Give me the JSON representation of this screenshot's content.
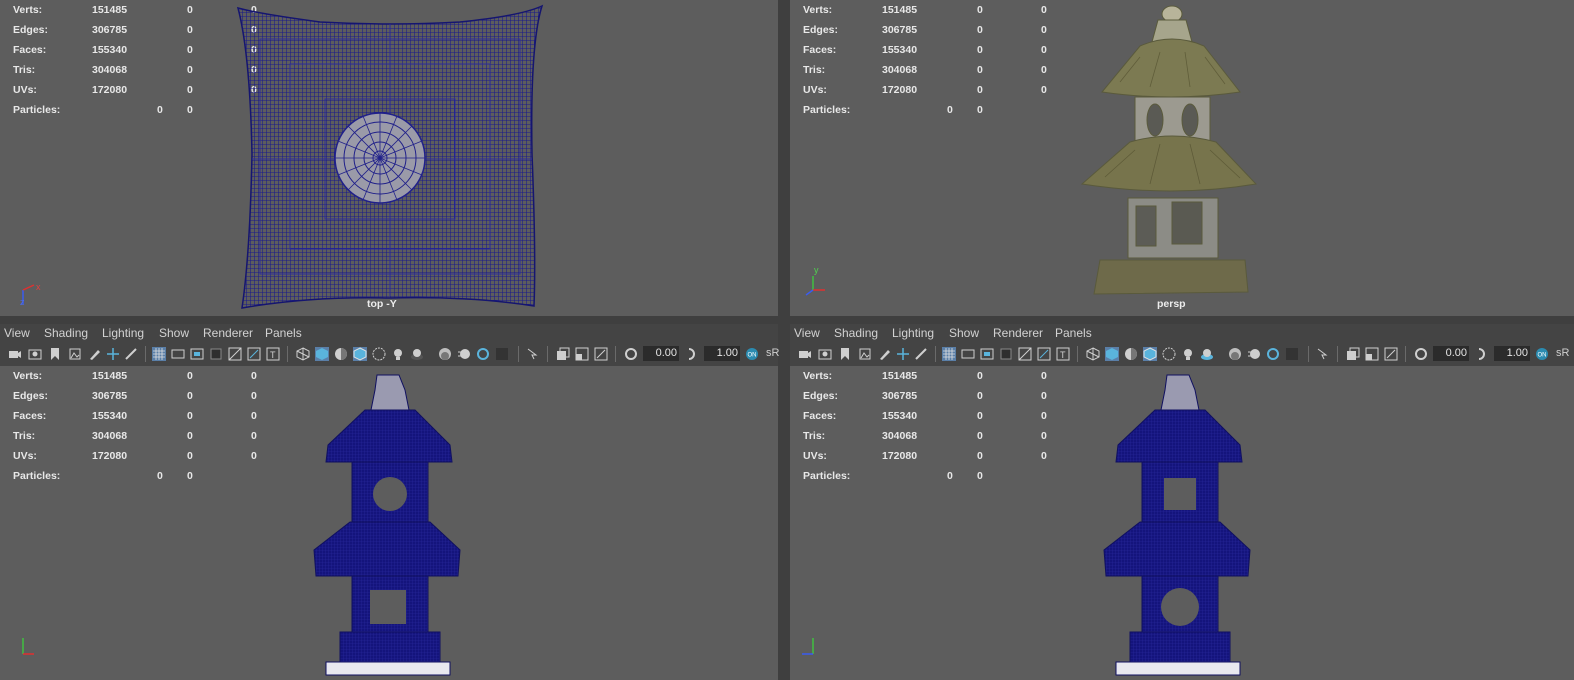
{
  "stats": {
    "rows": [
      {
        "label": "Verts:",
        "total": "151485",
        "sel1": "0",
        "sel2": "0"
      },
      {
        "label": "Edges:",
        "total": "306785",
        "sel1": "0",
        "sel2": "0"
      },
      {
        "label": "Faces:",
        "total": "155340",
        "sel1": "0",
        "sel2": "0"
      },
      {
        "label": "Tris:",
        "total": "304068",
        "sel1": "0",
        "sel2": "0"
      },
      {
        "label": "UVs:",
        "total": "172080",
        "sel1": "0",
        "sel2": "0"
      }
    ],
    "particles": {
      "label": "Particles:",
      "v1": "0",
      "v2": "0"
    }
  },
  "viewports": {
    "top": {
      "name": "top -Y"
    },
    "persp": {
      "name": "persp"
    }
  },
  "menu": [
    "View",
    "Shading",
    "Lighting",
    "Show",
    "Renderer",
    "Panels"
  ],
  "toolbar": {
    "exposure": "0.00",
    "gamma": "1.00",
    "color_space": "sR"
  },
  "axis": {
    "x": "x",
    "y": "y",
    "z": "z"
  },
  "colors": {
    "viewport_bg": "#5d5d5d",
    "wire": "#1c1c8c",
    "panel": "#444444",
    "accent": "#5ab4dc"
  }
}
